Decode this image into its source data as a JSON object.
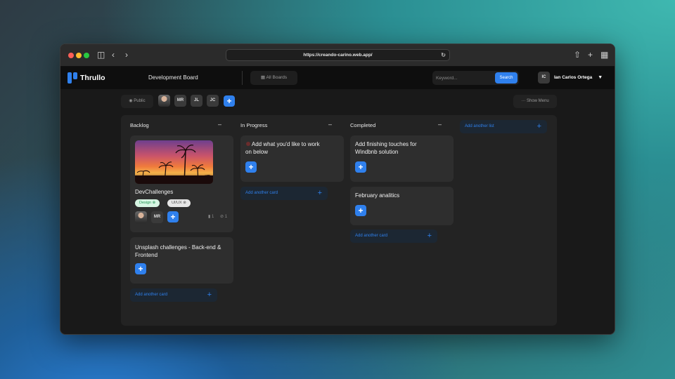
{
  "browser": {
    "url": "https://creando-carino.web.app/"
  },
  "app": {
    "name": "Thrullo",
    "board_title": "Development Board",
    "all_boards_label": "All Boards",
    "search": {
      "placeholder": "Keyword...",
      "button": "Search"
    },
    "user": {
      "initials": "IC",
      "name": "Ian Carlos Ortega"
    }
  },
  "subbar": {
    "visibility": "Public",
    "members": [
      "MR",
      "JL",
      "JC"
    ],
    "show_menu": "Show Menu"
  },
  "lists": [
    {
      "title": "Backlog",
      "cards": [
        {
          "title": "DevChallenges",
          "has_cover": true,
          "tags": [
            "Design",
            "UI/UX"
          ],
          "members": [
            "MR"
          ],
          "comments": "1",
          "attachments": "1"
        },
        {
          "title_line1": "Unsplash challenges - Back-end &",
          "title_line2": "Frontend"
        }
      ],
      "add_card": "Add another card"
    },
    {
      "title": "In Progress",
      "cards": [
        {
          "title_line1": "Add what you'd like to work",
          "title_line2": "on below"
        }
      ],
      "add_card": "Add another card"
    },
    {
      "title": "Completed",
      "cards": [
        {
          "title_line1": "Add finishing touches for",
          "title_line2": "Windbnb solution"
        },
        {
          "title": "February analitics"
        }
      ],
      "add_card": "Add another card"
    }
  ],
  "add_list": "Add another list",
  "colors": {
    "accent": "#2f80ed",
    "window_bg": "#191919",
    "card_bg": "#2e2e2e"
  }
}
